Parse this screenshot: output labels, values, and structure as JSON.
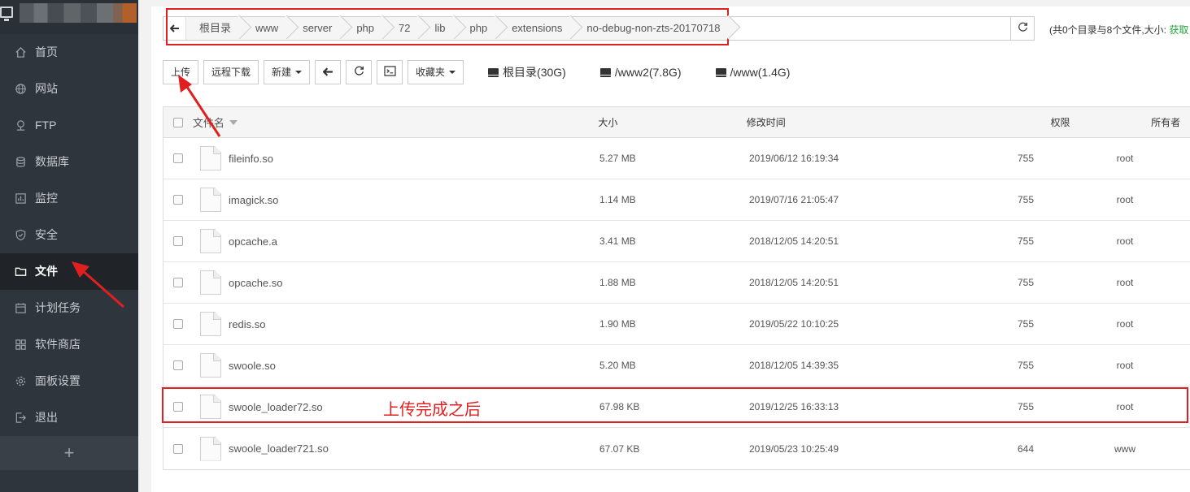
{
  "sidebar": {
    "items": [
      {
        "label": "首页",
        "icon": "home-icon"
      },
      {
        "label": "网站",
        "icon": "globe-icon"
      },
      {
        "label": "FTP",
        "icon": "ftp-icon"
      },
      {
        "label": "数据库",
        "icon": "database-icon"
      },
      {
        "label": "监控",
        "icon": "monitor-icon"
      },
      {
        "label": "安全",
        "icon": "shield-icon"
      },
      {
        "label": "文件",
        "icon": "folder-icon",
        "active": true
      },
      {
        "label": "计划任务",
        "icon": "calendar-icon"
      },
      {
        "label": "软件商店",
        "icon": "grid-icon"
      },
      {
        "label": "面板设置",
        "icon": "gear-icon"
      },
      {
        "label": "退出",
        "icon": "logout-icon"
      }
    ],
    "add_label": "+"
  },
  "path": {
    "crumbs": [
      "根目录",
      "www",
      "server",
      "php",
      "72",
      "lib",
      "php",
      "extensions",
      "no-debug-non-zts-20170718"
    ]
  },
  "summary": {
    "text": "(共0个目录与8个文件,大小: ",
    "link": "获取"
  },
  "toolbar": {
    "upload": "上传",
    "remote_download": "远程下载",
    "new": "新建",
    "favorites": "收藏夹",
    "disks": [
      {
        "label": "根目录(30G)"
      },
      {
        "label": "/www2(7.8G)"
      },
      {
        "label": "/www(1.4G)"
      }
    ]
  },
  "table": {
    "headers": {
      "name": "文件名",
      "size": "大小",
      "mtime": "修改时间",
      "perm": "权限",
      "owner": "所有者"
    },
    "rows": [
      {
        "name": "fileinfo.so",
        "size": "5.27 MB",
        "mtime": "2019/06/12 16:19:34",
        "perm": "755",
        "owner": "root"
      },
      {
        "name": "imagick.so",
        "size": "1.14 MB",
        "mtime": "2019/07/16 21:05:47",
        "perm": "755",
        "owner": "root"
      },
      {
        "name": "opcache.a",
        "size": "3.41 MB",
        "mtime": "2018/12/05 14:20:51",
        "perm": "755",
        "owner": "root"
      },
      {
        "name": "opcache.so",
        "size": "1.88 MB",
        "mtime": "2018/12/05 14:20:51",
        "perm": "755",
        "owner": "root"
      },
      {
        "name": "redis.so",
        "size": "1.90 MB",
        "mtime": "2019/05/22 10:10:25",
        "perm": "755",
        "owner": "root"
      },
      {
        "name": "swoole.so",
        "size": "5.20 MB",
        "mtime": "2018/12/05 14:39:35",
        "perm": "755",
        "owner": "root"
      },
      {
        "name": "swoole_loader72.so",
        "size": "67.98 KB",
        "mtime": "2019/12/25 16:33:13",
        "perm": "755",
        "owner": "root"
      },
      {
        "name": "swoole_loader721.so",
        "size": "67.07 KB",
        "mtime": "2019/05/23 10:25:49",
        "perm": "644",
        "owner": "www"
      }
    ]
  },
  "annotation": {
    "text": "上传完成之后",
    "color": "#e02020"
  },
  "colors": {
    "sidebar_bg": "#2f353c",
    "sidebar_active": "#202428",
    "accent_green": "#20a53a",
    "highlight_red": "#e02020"
  }
}
